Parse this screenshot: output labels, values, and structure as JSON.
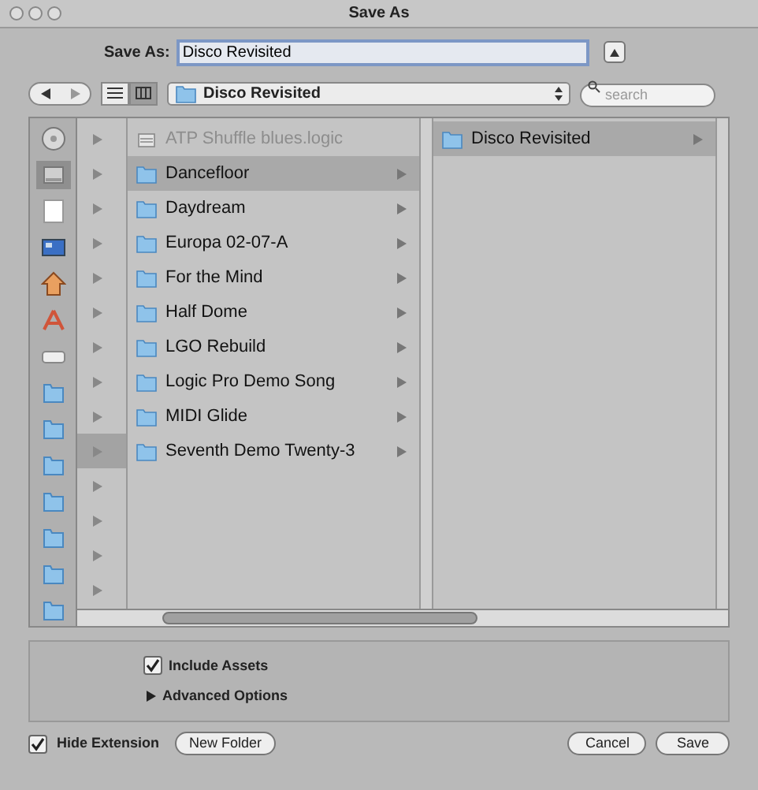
{
  "window": {
    "title": "Save As"
  },
  "save_as": {
    "label": "Save As:",
    "value": "Disco Revisited"
  },
  "toolbar": {
    "location": "Disco Revisited",
    "search_placeholder": "search",
    "views": [
      {
        "kind": "list",
        "selected": false
      },
      {
        "kind": "column",
        "selected": true
      }
    ]
  },
  "sidebar": {
    "items": [
      {
        "kind": "disk",
        "selected": false
      },
      {
        "kind": "drive",
        "selected": true
      },
      {
        "kind": "page",
        "selected": false
      },
      {
        "kind": "screen",
        "selected": false
      },
      {
        "kind": "home",
        "selected": false
      },
      {
        "kind": "apps",
        "selected": false
      },
      {
        "kind": "device",
        "selected": false
      },
      {
        "kind": "folder",
        "selected": false
      },
      {
        "kind": "folder",
        "selected": false
      },
      {
        "kind": "folder",
        "selected": false
      },
      {
        "kind": "folder",
        "selected": false
      },
      {
        "kind": "folder",
        "selected": false
      },
      {
        "kind": "folder",
        "selected": false
      },
      {
        "kind": "folder",
        "selected": false
      }
    ]
  },
  "columns": [
    {
      "items": [
        {
          "selected": false
        },
        {
          "selected": false
        },
        {
          "selected": false
        },
        {
          "selected": false
        },
        {
          "selected": false
        },
        {
          "selected": false
        },
        {
          "selected": false
        },
        {
          "selected": false
        },
        {
          "selected": false
        },
        {
          "selected": true
        },
        {
          "selected": false
        },
        {
          "selected": false
        },
        {
          "selected": false
        },
        {
          "selected": false
        }
      ]
    },
    {
      "items": [
        {
          "name": "ATP Shuffle  blues.logic",
          "kind": "file",
          "disabled": true,
          "selected": false
        },
        {
          "name": "Dancefloor",
          "kind": "folder",
          "disabled": false,
          "selected": true
        },
        {
          "name": "Daydream",
          "kind": "folder",
          "disabled": false,
          "selected": false
        },
        {
          "name": "Europa 02-07-A",
          "kind": "folder",
          "disabled": false,
          "selected": false
        },
        {
          "name": "For the Mind",
          "kind": "folder",
          "disabled": false,
          "selected": false
        },
        {
          "name": "Half Dome",
          "kind": "folder",
          "disabled": false,
          "selected": false
        },
        {
          "name": "LGO Rebuild",
          "kind": "folder",
          "disabled": false,
          "selected": false
        },
        {
          "name": "Logic Pro Demo Song",
          "kind": "folder",
          "disabled": false,
          "selected": false
        },
        {
          "name": "MIDI Glide",
          "kind": "folder",
          "disabled": false,
          "selected": false
        },
        {
          "name": "Seventh Demo Twenty-3",
          "kind": "folder",
          "disabled": false,
          "selected": false
        }
      ]
    },
    {
      "items": [
        {
          "name": "Disco Revisited",
          "kind": "folder",
          "disabled": false,
          "selected": true
        }
      ]
    }
  ],
  "options": {
    "include_assets": {
      "label": "Include Assets",
      "checked": true
    },
    "advanced": {
      "label": "Advanced Options",
      "expanded": false
    }
  },
  "bottom": {
    "hide_extension": {
      "label": "Hide Extension",
      "checked": true
    },
    "new_folder": "New Folder",
    "cancel": "Cancel",
    "save": "Save"
  }
}
